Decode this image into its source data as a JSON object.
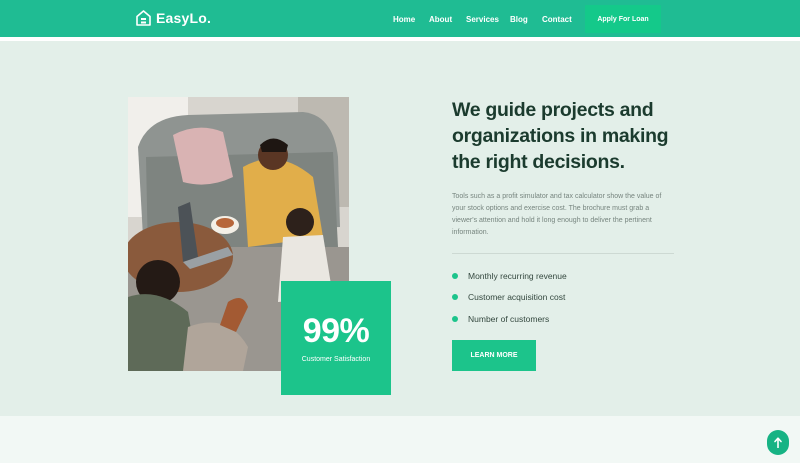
{
  "brand": {
    "name": "EasyLo."
  },
  "nav": {
    "items": [
      "Home",
      "About",
      "Services",
      "Blog",
      "Contact"
    ]
  },
  "header": {
    "cta_label": "Apply For Loan"
  },
  "about": {
    "heading": "We guide projects and organizations in making the right decisions.",
    "description": "Tools such as a profit simulator and tax calculator show the value of your stock options and exercise cost. The brochure must grab a viewer's attention and hold it long enough to deliver the pertinent information.",
    "features": [
      "Monthly recurring revenue",
      "Customer acquisition cost",
      "Number of customers"
    ],
    "button_label": "LEARN MORE",
    "stat": {
      "value": "99%",
      "label": "Customer Satisfaction"
    }
  },
  "colors": {
    "primary": "#1fbc93",
    "accent": "#1cc48b",
    "heading": "#1b3b2e",
    "section_bg": "#e3efe9"
  },
  "icons": {
    "logo": "house-icon",
    "scroll_top": "arrow-up-icon"
  }
}
